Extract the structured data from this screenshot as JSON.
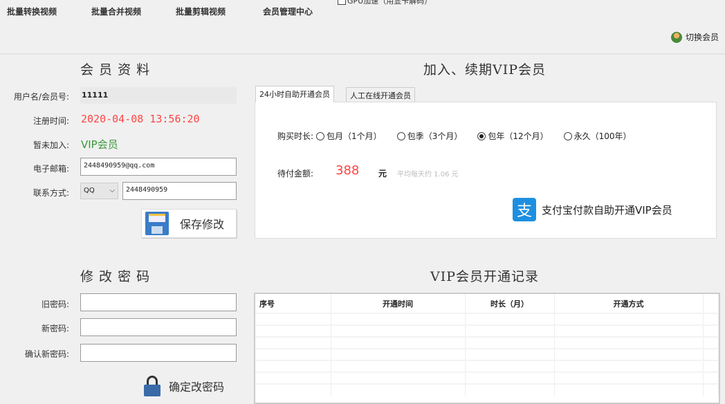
{
  "menu": [
    "批量转换视频",
    "批量合并视频",
    "批量剪辑视频",
    "会员管理中心"
  ],
  "gpu_checkbox": "GPU加速（用显卡解码）",
  "switch_member": "切换会员",
  "profile": {
    "title": "会 员 资 料",
    "username_label": "用户名/会员号:",
    "username": "11111",
    "reg_label": "注册时间:",
    "reg_time": "2020-04-08 13:56:20",
    "status_label": "暂未加入:",
    "status": "VIP会员",
    "email_label": "电子邮箱:",
    "email": "2448490959@qq.com",
    "contact_label": "联系方式:",
    "contact_type": "QQ",
    "contact": "2448490959",
    "save": "保存修改"
  },
  "password": {
    "title": "修 改 密 码",
    "old_label": "旧密码:",
    "new_label": "新密码:",
    "confirm_label": "确认新密码:",
    "submit": "确定改密码"
  },
  "vip": {
    "title": "加入、续期VIP会员",
    "tabs": [
      "24小时自助开通会员",
      "人工在线开通会员"
    ],
    "duration_label": "购买时长:",
    "options": [
      {
        "label": "包月（1个月）",
        "selected": false
      },
      {
        "label": "包季（3个月）",
        "selected": false
      },
      {
        "label": "包年（12个月）",
        "selected": true
      },
      {
        "label": "永久（100年）",
        "selected": false
      }
    ],
    "amount_label": "待付金额:",
    "amount": "388",
    "unit": "元",
    "daily": "平均每天约 1.06 元",
    "alipay": "支付宝付款自助开通VIP会员",
    "alipay_icon_text": "支"
  },
  "records": {
    "title": "VIP会员开通记录",
    "columns": [
      "序号",
      "开通时间",
      "时长（月）",
      "开通方式"
    ]
  },
  "colors": {
    "red": "#ff4444",
    "green": "#3a9a3a",
    "alipay": "#1e8fe0"
  }
}
